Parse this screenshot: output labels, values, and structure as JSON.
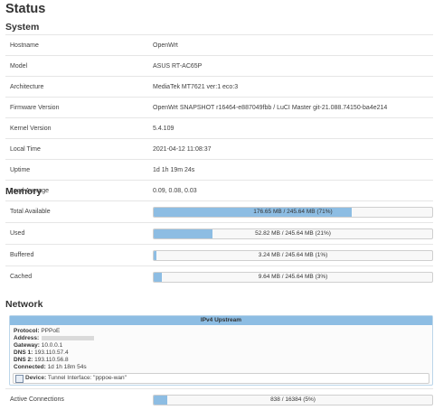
{
  "page_title": "Status",
  "system": {
    "heading": "System",
    "rows": [
      {
        "label": "Hostname",
        "value": "OpenWrt"
      },
      {
        "label": "Model",
        "value": "ASUS RT-AC65P"
      },
      {
        "label": "Architecture",
        "value": "MediaTek MT7621 ver:1 eco:3"
      },
      {
        "label": "Firmware Version",
        "value": "OpenWrt SNAPSHOT r16464-e887049fbb / LuCI Master git-21.088.74150-ba4e214"
      },
      {
        "label": "Kernel Version",
        "value": "5.4.109"
      },
      {
        "label": "Local Time",
        "value": "2021-04-12 11:08:37"
      },
      {
        "label": "Uptime",
        "value": "1d 1h 19m 24s"
      },
      {
        "label": "Load Average",
        "value": "0.09, 0.08, 0.03"
      }
    ]
  },
  "memory": {
    "heading": "Memory",
    "rows": [
      {
        "label": "Total Available",
        "text": "176.65 MB / 245.64 MB (71%)",
        "fraction": 0.71
      },
      {
        "label": "Used",
        "text": "52.82 MB / 245.64 MB (21%)",
        "fraction": 0.21
      },
      {
        "label": "Buffered",
        "text": "3.24 MB / 245.64 MB (1%)",
        "fraction": 0.01
      },
      {
        "label": "Cached",
        "text": "9.64 MB / 245.64 MB (3%)",
        "fraction": 0.03
      }
    ]
  },
  "network": {
    "heading": "Network",
    "upstream": {
      "title": "IPv4 Upstream",
      "protocol_label": "Protocol:",
      "protocol": "PPPoE",
      "address_label": "Address:",
      "gateway_label": "Gateway:",
      "gateway": "10.0.0.1",
      "dns1_label": "DNS 1:",
      "dns1": "193.110.57.4",
      "dns2_label": "DNS 2:",
      "dns2": "193.110.56.8",
      "connected_label": "Connected:",
      "connected": "1d 1h 18m 54s",
      "device_label": "Device:",
      "device": "Tunnel Interface: \"pppoe-wan\""
    },
    "connections": {
      "label": "Active Connections",
      "text": "838 / 16384 (5%)",
      "fraction": 0.05
    }
  },
  "colors": {
    "bar_fill": "#8dbde3",
    "bar_bg": "#f8f8f8"
  }
}
